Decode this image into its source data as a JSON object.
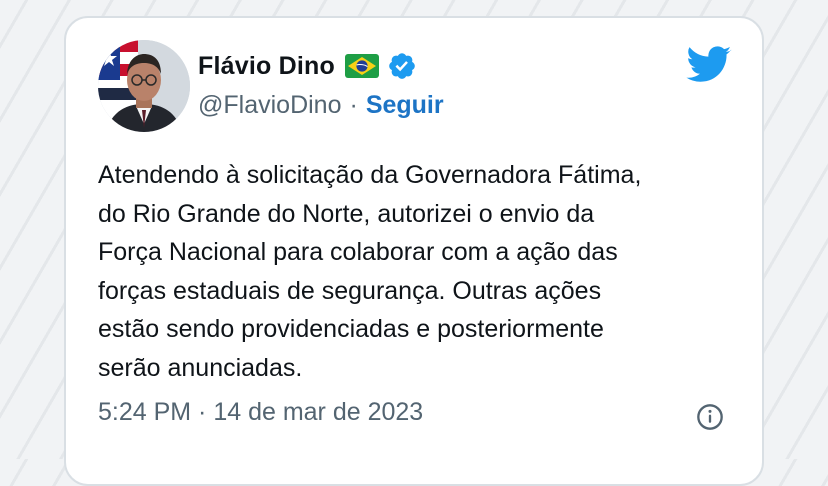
{
  "tweet": {
    "author_name": "Flávio Dino",
    "handle": "@FlavioDino",
    "separator": "·",
    "follow_label": "Seguir",
    "body_lines": [
      "Atendendo à solicitação da Governadora Fátima,",
      "do Rio Grande do Norte, autorizei o envio da",
      "Força Nacional para colaborar com a ação das",
      "forças estaduais de segurança. Outras ações",
      "estão sendo providenciadas e posteriormente",
      "serão anunciadas."
    ],
    "timestamp": "5:24 PM · 14 de mar de 2023"
  },
  "icons": {
    "flag": "brazil-flag-icon",
    "verified": "verified-badge-icon",
    "platform": "twitter-bird-icon",
    "info": "info-icon"
  },
  "colors": {
    "twitter_blue": "#1d9bf0",
    "link_blue": "#1d74c5",
    "text_primary": "#0f1419",
    "text_secondary": "#536471"
  }
}
